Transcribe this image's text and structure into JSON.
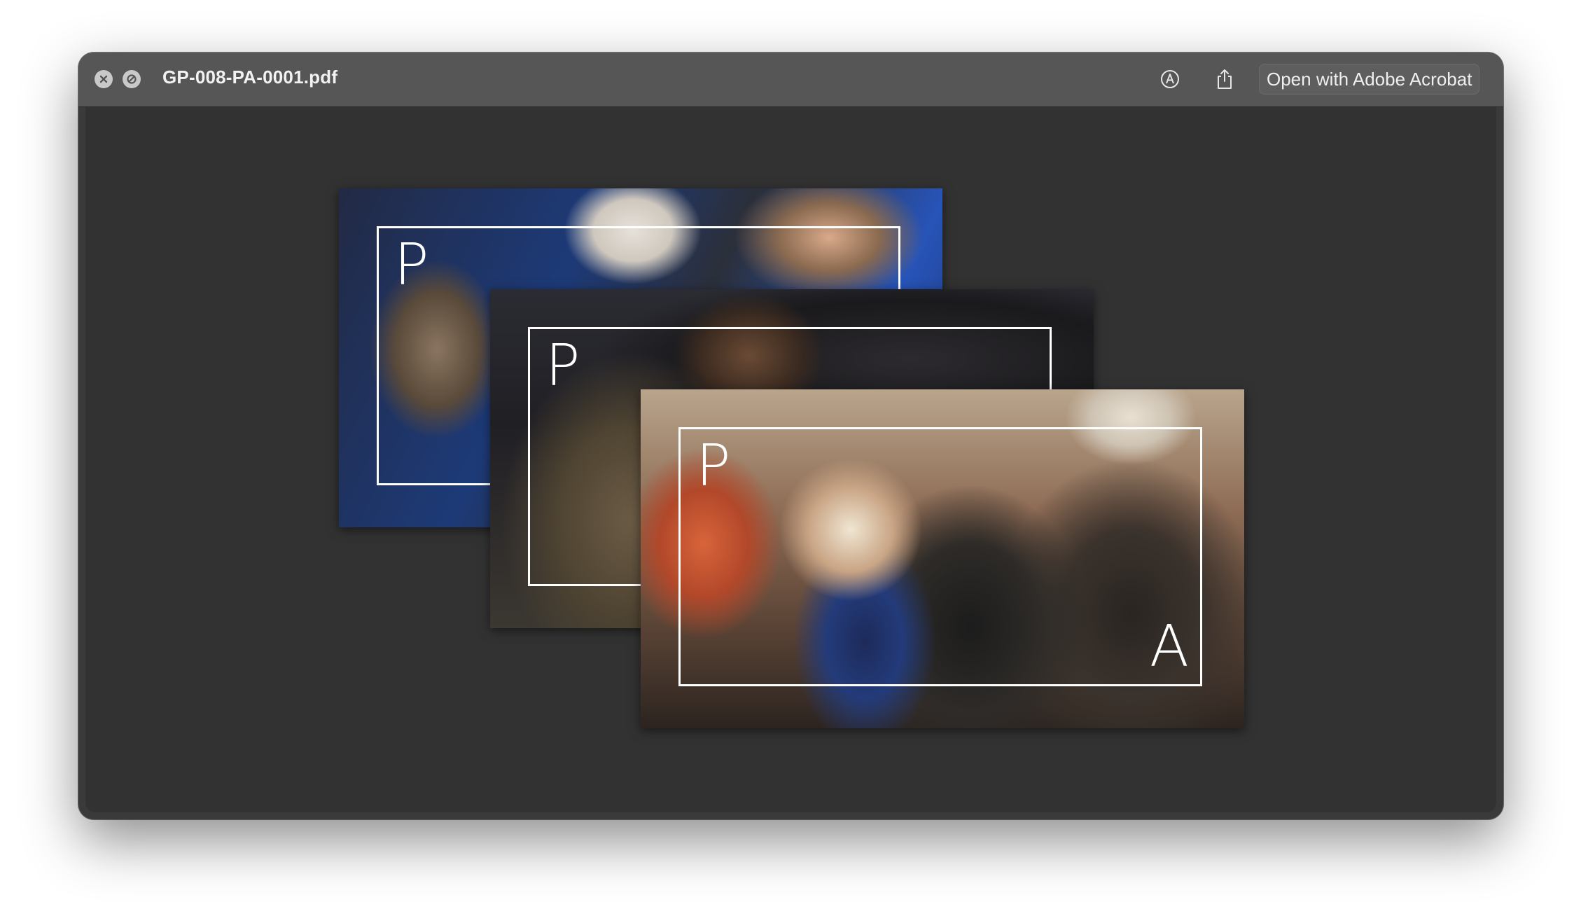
{
  "window": {
    "title": "GP-008-PA-0001.pdf",
    "open_button_label": "Open with Adobe Acrobat"
  },
  "toolbar": {
    "close_icon": "close-icon",
    "block_icon": "block-icon",
    "markup_icon": "markup-icon",
    "share_icon": "share-icon"
  },
  "pages": [
    {
      "frame_letter": "P"
    },
    {
      "frame_letter": "P"
    },
    {
      "frame_letter_top": "P",
      "frame_letter_bottom": "A"
    }
  ],
  "colors": {
    "titlebar": "#565656",
    "content_background": "#323232",
    "frame_stroke": "#ffffff"
  }
}
